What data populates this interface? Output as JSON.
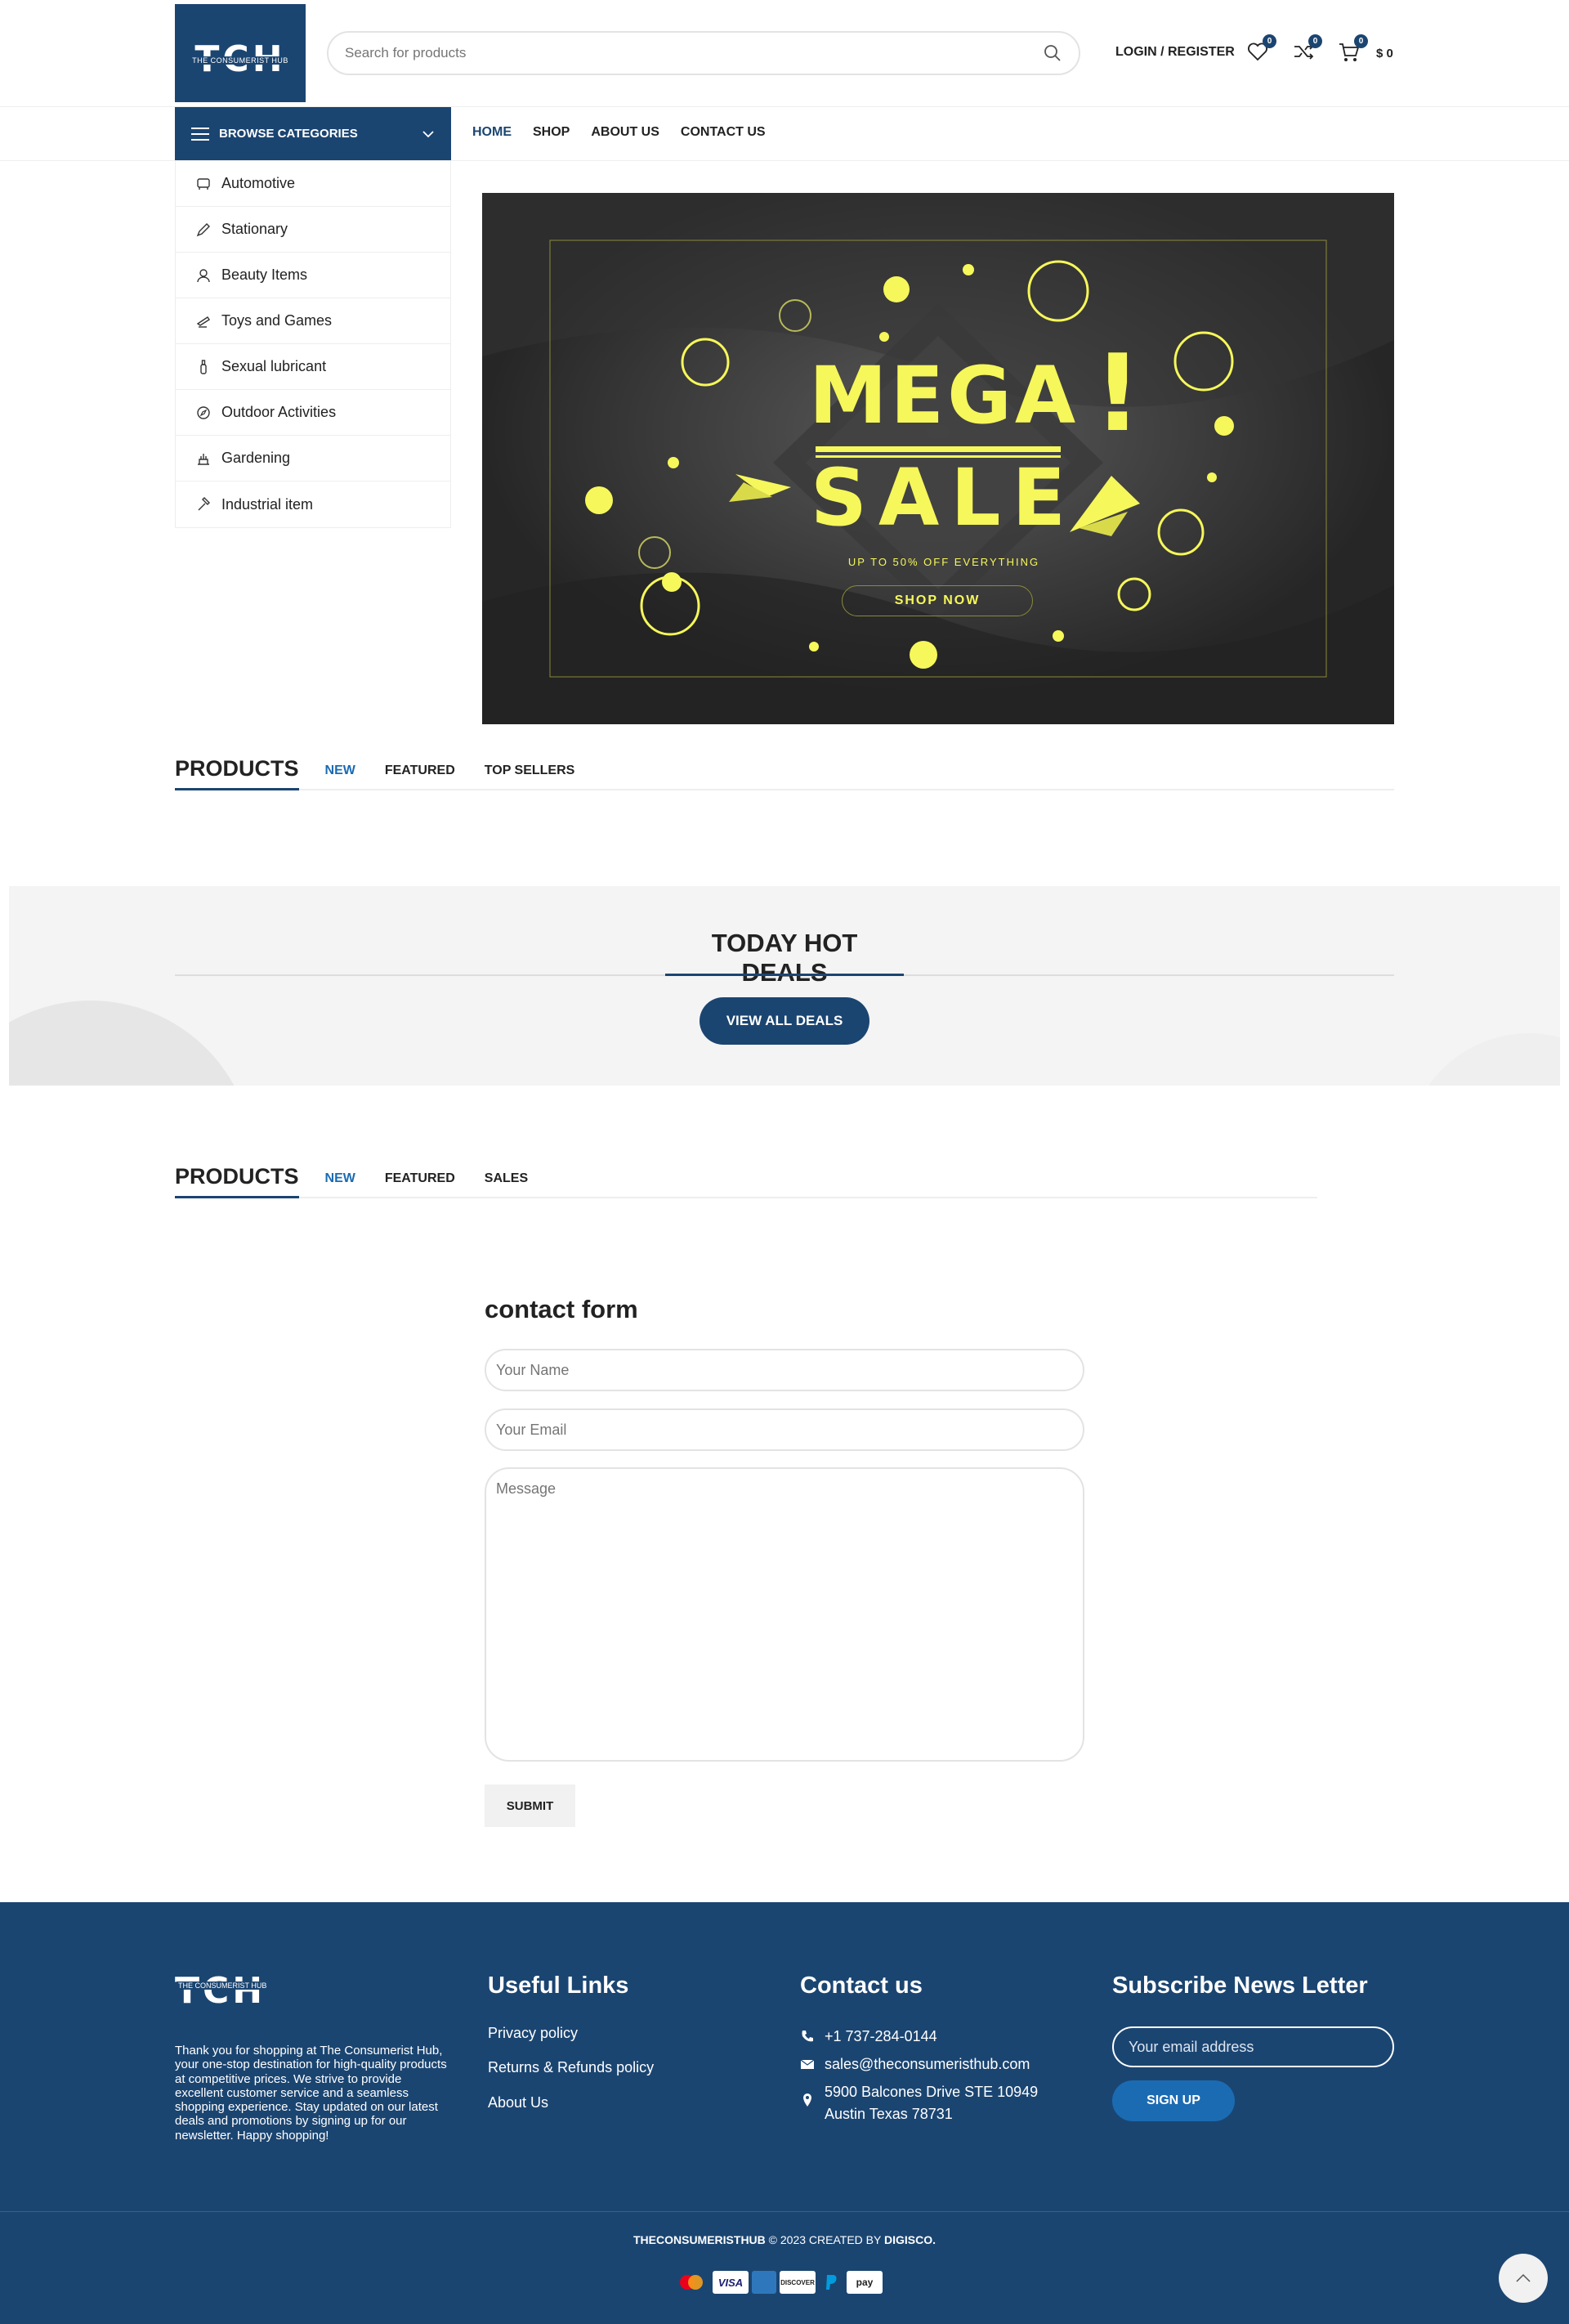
{
  "header": {
    "logo_text": "TCH",
    "logo_subtext": "THE CONSUMERIST HUB",
    "search_placeholder": "Search for products",
    "login_label": "LOGIN / REGISTER",
    "wishlist_count": "0",
    "compare_count": "0",
    "cart_count": "0",
    "cart_total": "$ 0"
  },
  "categories": {
    "browse_label": "BROWSE CATEGORIES",
    "items": [
      {
        "label": "Automotive",
        "icon": "car-seat-icon"
      },
      {
        "label": "Stationary",
        "icon": "pen-icon"
      },
      {
        "label": "Beauty Items",
        "icon": "person-icon"
      },
      {
        "label": "Toys and Games",
        "icon": "toy-icon"
      },
      {
        "label": "Sexual lubricant",
        "icon": "bottle-icon"
      },
      {
        "label": "Outdoor Activities",
        "icon": "compass-icon"
      },
      {
        "label": "Gardening",
        "icon": "garden-icon"
      },
      {
        "label": "Industrial item",
        "icon": "hammer-icon"
      }
    ]
  },
  "nav": {
    "items": [
      "HOME",
      "SHOP",
      "ABOUT US",
      "CONTACT US"
    ],
    "active": "HOME"
  },
  "banner": {
    "line1": "MEGA",
    "line2": "SALE",
    "exclaim": "!",
    "tagline": "UP TO 50% OFF EVERYTHING",
    "cta": "SHOP NOW",
    "colors": {
      "bg": "#2a2a2a",
      "accent": "#f6f75a"
    }
  },
  "products1": {
    "title": "PRODUCTS",
    "tabs": [
      "NEW",
      "FEATURED",
      "TOP SELLERS"
    ]
  },
  "deals": {
    "title": "TODAY HOT DEALS",
    "button": "VIEW ALL DEALS"
  },
  "products2": {
    "title": "PRODUCTS",
    "tabs": [
      "NEW",
      "FEATURED",
      "SALES"
    ]
  },
  "contact_form": {
    "title": "contact form",
    "name_placeholder": "Your Name",
    "email_placeholder": "Your Email",
    "message_placeholder": "Message",
    "submit": "SUBMIT"
  },
  "footer": {
    "logo_text": "TCH",
    "logo_subtext": "THE CONSUMERIST HUB",
    "about": "Thank you for shopping at The Consumerist Hub, your one-stop destination for high-quality products at competitive prices. We strive to provide excellent customer service and a seamless shopping experience. Stay updated on our latest deals and promotions by signing up for our newsletter. Happy shopping!",
    "useful_links_title": "Useful Links",
    "useful_links": [
      "Privacy policy",
      "Returns & Refunds policy",
      "About Us"
    ],
    "contact_title": "Contact us",
    "phone": "+1 737-284-0144",
    "email": "sales@theconsumeristhub.com",
    "address": "5900 Balcones Drive STE 10949 Austin Texas 78731",
    "newsletter_title": "Subscribe News Letter",
    "newsletter_placeholder": "Your email address",
    "signup": "SIGN UP",
    "copyright_brand": "THECONSUMERISTHUB",
    "copyright_text": " 2023 CREATED BY ",
    "copyright_creator": "DIGISCO.",
    "payments": [
      "mastercard",
      "VISA",
      "amex",
      "DISCOVER",
      "paypal",
      "pay"
    ],
    "brand_color": "#1b4571"
  }
}
